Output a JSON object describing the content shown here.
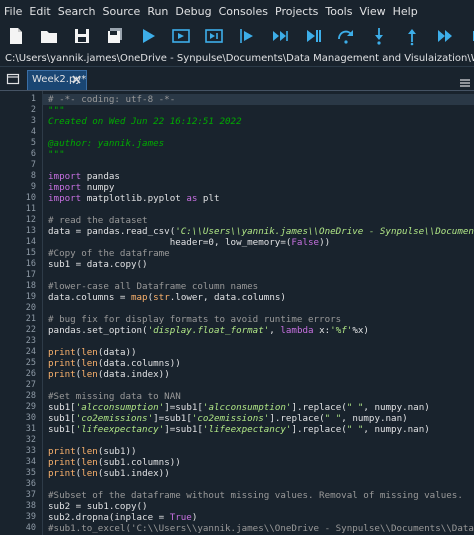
{
  "menu": [
    "File",
    "Edit",
    "Search",
    "Source",
    "Run",
    "Debug",
    "Consoles",
    "Projects",
    "Tools",
    "View",
    "Help"
  ],
  "toolbar": {
    "icons": [
      "new-file-icon",
      "open-file-icon",
      "save-file-icon",
      "save-all-icon",
      "run-icon",
      "run-cell-icon",
      "run-cell-advance-icon",
      "run-selection-icon",
      "re-run-icon",
      "debug-icon",
      "step-icon",
      "step-into-icon",
      "step-return-icon",
      "continue-icon",
      "stop-debug-icon"
    ],
    "accent": "#3daee9"
  },
  "path": "C:\\Users\\yannik.james\\OneDrive - Synpulse\\Documents\\Data Management and Visulaization\\Week2.py",
  "tab": {
    "label": "Week2.py*"
  },
  "editor": {
    "current_line": 1,
    "lines": [
      [
        [
          "comment",
          "# -*- coding: utf-8 -*-"
        ]
      ],
      [
        [
          "docstring",
          "\"\"\""
        ]
      ],
      [
        [
          "docstring",
          "Created on Wed Jun 22 16:12:51 2022"
        ]
      ],
      [
        [
          "default",
          ""
        ]
      ],
      [
        [
          "docstring",
          "@author: yannik.james"
        ]
      ],
      [
        [
          "docstring",
          "\"\"\""
        ]
      ],
      [
        [
          "default",
          ""
        ]
      ],
      [
        [
          "keyword",
          "import"
        ],
        [
          "default",
          " pandas"
        ]
      ],
      [
        [
          "keyword",
          "import"
        ],
        [
          "default",
          " numpy"
        ]
      ],
      [
        [
          "keyword",
          "import"
        ],
        [
          "default",
          " matplotlib.pyplot "
        ],
        [
          "keyword",
          "as"
        ],
        [
          "default",
          " plt"
        ]
      ],
      [
        [
          "default",
          ""
        ]
      ],
      [
        [
          "comment",
          "# read the dataset"
        ]
      ],
      [
        [
          "default",
          "data = pandas.read_csv("
        ],
        [
          "string",
          "'C:\\\\Users\\\\yannik.james\\\\OneDrive - Synpulse\\\\Documents\\\\Da"
        ]
      ],
      [
        [
          "default",
          "                      header=0, low_memory=("
        ],
        [
          "keyword",
          "False"
        ],
        [
          "default",
          "))"
        ]
      ],
      [
        [
          "comment",
          "#Copy of the dataframe"
        ]
      ],
      [
        [
          "default",
          "sub1 = data.copy()"
        ]
      ],
      [
        [
          "default",
          ""
        ]
      ],
      [
        [
          "comment",
          "#lower-case all Dataframe column names"
        ]
      ],
      [
        [
          "default",
          "data.columns = "
        ],
        [
          "builtin",
          "map"
        ],
        [
          "default",
          "("
        ],
        [
          "builtin",
          "str"
        ],
        [
          "default",
          ".lower, data.columns)"
        ]
      ],
      [
        [
          "default",
          ""
        ]
      ],
      [
        [
          "comment",
          "# bug fix for display formats to avoid runtime errors"
        ]
      ],
      [
        [
          "default",
          "pandas.set_option("
        ],
        [
          "string",
          "'display.float_format'"
        ],
        [
          "default",
          ", "
        ],
        [
          "keyword",
          "lambda"
        ],
        [
          "default",
          " x:"
        ],
        [
          "string",
          "'%f'"
        ],
        [
          "default",
          "%x)"
        ]
      ],
      [
        [
          "default",
          ""
        ]
      ],
      [
        [
          "builtin",
          "print"
        ],
        [
          "default",
          "("
        ],
        [
          "builtin",
          "len"
        ],
        [
          "default",
          "(data))"
        ]
      ],
      [
        [
          "builtin",
          "print"
        ],
        [
          "default",
          "("
        ],
        [
          "builtin",
          "len"
        ],
        [
          "default",
          "(data.columns))"
        ]
      ],
      [
        [
          "builtin",
          "print"
        ],
        [
          "default",
          "("
        ],
        [
          "builtin",
          "len"
        ],
        [
          "default",
          "(data.index))"
        ]
      ],
      [
        [
          "default",
          ""
        ]
      ],
      [
        [
          "comment",
          "#Set missing data to NAN"
        ]
      ],
      [
        [
          "default",
          "sub1["
        ],
        [
          "string",
          "'alcconsumption'"
        ],
        [
          "default",
          "]=sub1["
        ],
        [
          "string",
          "'alcconsumption'"
        ],
        [
          "default",
          "].replace("
        ],
        [
          "string",
          "\" \""
        ],
        [
          "default",
          ", numpy.nan)"
        ]
      ],
      [
        [
          "default",
          "sub1["
        ],
        [
          "string",
          "'co2emissions'"
        ],
        [
          "default",
          "]=sub1["
        ],
        [
          "string",
          "'co2emissions'"
        ],
        [
          "default",
          "].replace("
        ],
        [
          "string",
          "\" \""
        ],
        [
          "default",
          ", numpy.nan)"
        ]
      ],
      [
        [
          "default",
          "sub1["
        ],
        [
          "string",
          "'lifeexpectancy'"
        ],
        [
          "default",
          "]=sub1["
        ],
        [
          "string",
          "'lifeexpectancy'"
        ],
        [
          "default",
          "].replace("
        ],
        [
          "string",
          "\" \""
        ],
        [
          "default",
          ", numpy.nan)"
        ]
      ],
      [
        [
          "default",
          ""
        ]
      ],
      [
        [
          "builtin",
          "print"
        ],
        [
          "default",
          "("
        ],
        [
          "builtin",
          "len"
        ],
        [
          "default",
          "(sub1))"
        ]
      ],
      [
        [
          "builtin",
          "print"
        ],
        [
          "default",
          "("
        ],
        [
          "builtin",
          "len"
        ],
        [
          "default",
          "(sub1.columns))"
        ]
      ],
      [
        [
          "builtin",
          "print"
        ],
        [
          "default",
          "("
        ],
        [
          "builtin",
          "len"
        ],
        [
          "default",
          "(sub1.index))"
        ]
      ],
      [
        [
          "default",
          ""
        ]
      ],
      [
        [
          "comment",
          "#Subset of the dataframe without missing values. Removal of missing values."
        ]
      ],
      [
        [
          "default",
          "sub2 = sub1.copy()"
        ]
      ],
      [
        [
          "default",
          "sub2.dropna(inplace = "
        ],
        [
          "keyword",
          "True"
        ],
        [
          "default",
          ")"
        ]
      ],
      [
        [
          "comment",
          "#sub1.to_excel('C:\\\\Users\\\\yannik.james\\\\OneDrive - Synpulse\\\\Documents\\\\Data Manag"
        ]
      ]
    ]
  }
}
